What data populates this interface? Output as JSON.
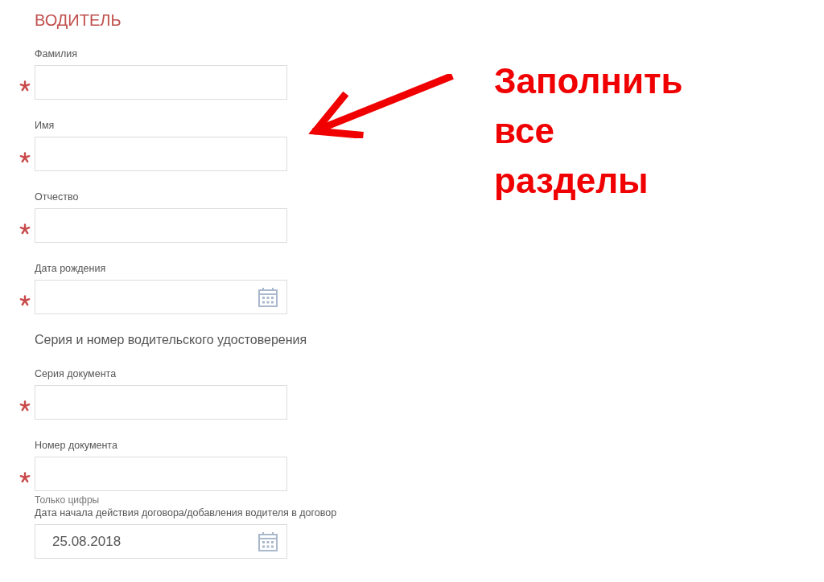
{
  "form": {
    "title": "ВОДИТЕЛЬ",
    "items": [
      {
        "kind": "field",
        "label": "Фамилия",
        "required": true,
        "calendar": false
      },
      {
        "kind": "field",
        "label": "Имя",
        "required": true,
        "calendar": false
      },
      {
        "kind": "field",
        "label": "Отчество",
        "required": true,
        "calendar": false
      },
      {
        "kind": "field",
        "label": "Дата рождения",
        "required": true,
        "calendar": true
      },
      {
        "kind": "subheading",
        "label": "Серия и номер водительского удостоверения"
      },
      {
        "kind": "field",
        "label": "Серия документа",
        "required": true,
        "calendar": false
      },
      {
        "kind": "field",
        "label": "Номер документа",
        "required": true,
        "calendar": false,
        "hint": "Только цифры"
      },
      {
        "kind": "field",
        "label": "Дата начала действия договора/добавления водителя в договор",
        "required": false,
        "calendar": true,
        "value": "25.08.2018"
      }
    ]
  },
  "annotation": {
    "lines": [
      "Заполнить",
      "все",
      "разделы"
    ]
  }
}
